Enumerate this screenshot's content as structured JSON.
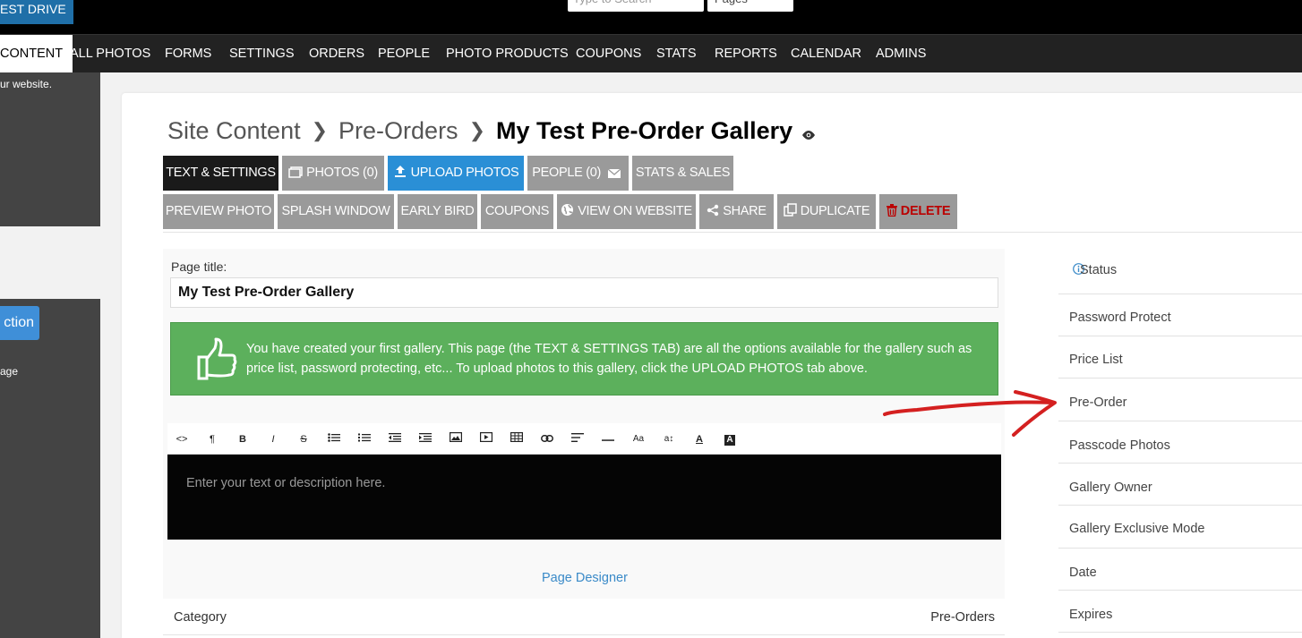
{
  "topbar": {
    "test_drive_label": "EST DRIVE",
    "search_placeholder": "Type to Search",
    "pages_select_value": "Pages"
  },
  "nav": {
    "items": [
      {
        "label": "CONTENT",
        "active": true
      },
      {
        "label": "ALL PHOTOS"
      },
      {
        "label": "FORMS"
      },
      {
        "label": "SETTINGS"
      },
      {
        "label": "ORDERS"
      },
      {
        "label": "PEOPLE"
      },
      {
        "label": "PHOTO PRODUCTS"
      },
      {
        "label": "COUPONS"
      },
      {
        "label": "STATS"
      },
      {
        "label": "REPORTS"
      },
      {
        "label": "CALENDAR"
      },
      {
        "label": "ADMINS"
      }
    ]
  },
  "sidebar": {
    "text1": "ur website.",
    "button_label": "ction",
    "text2": "age"
  },
  "breadcrumb": {
    "level1": "Site Content",
    "level2": "Pre-Orders",
    "current": "My Test Pre-Order Gallery"
  },
  "tabs": {
    "row1": [
      {
        "label": "TEXT & SETTINGS"
      },
      {
        "label": "PHOTOS (0)"
      },
      {
        "label": "UPLOAD PHOTOS"
      },
      {
        "label": "PEOPLE (0)"
      },
      {
        "label": "STATS & SALES"
      }
    ],
    "row2": [
      {
        "label": "PREVIEW PHOTO"
      },
      {
        "label": "SPLASH WINDOW"
      },
      {
        "label": "EARLY BIRD"
      },
      {
        "label": "COUPONS"
      },
      {
        "label": "VIEW ON WEBSITE"
      },
      {
        "label": "SHARE"
      },
      {
        "label": "DUPLICATE"
      },
      {
        "label": "DELETE"
      }
    ]
  },
  "form": {
    "page_title_label": "Page title:",
    "page_title_value": "My Test Pre-Order Gallery",
    "notice_text": "You have created your first gallery. This page (the TEXT & SETTINGS TAB) are all the options available for the gallery such as price list, password protecting, etc... To upload photos to this gallery, click the UPLOAD PHOTOS tab above.",
    "toolbar_text_labels": {
      "paragraph": "¶",
      "bold": "B",
      "italic": "I",
      "strike": "S",
      "font_size": "Aa",
      "line_height": "a↕",
      "font_color": "A",
      "bg_color": "A"
    },
    "editor_placeholder": "Enter your text or description here.",
    "page_designer_link": "Page Designer",
    "table": {
      "col_category": "Category",
      "col_preorders": "Pre-Orders"
    }
  },
  "settings": {
    "items": [
      {
        "label": "Status"
      },
      {
        "label": "Password Protect"
      },
      {
        "label": "Price List"
      },
      {
        "label": "Pre-Order"
      },
      {
        "label": "Passcode Photos"
      },
      {
        "label": "Gallery Owner"
      },
      {
        "label": "Gallery Exclusive Mode"
      },
      {
        "label": "Date"
      },
      {
        "label": "Expires"
      }
    ]
  },
  "colors": {
    "accent_blue": "#2a8fd6",
    "notice_green": "#5cb05c",
    "annotation_red": "#d42020",
    "delete_red": "#b00000"
  }
}
